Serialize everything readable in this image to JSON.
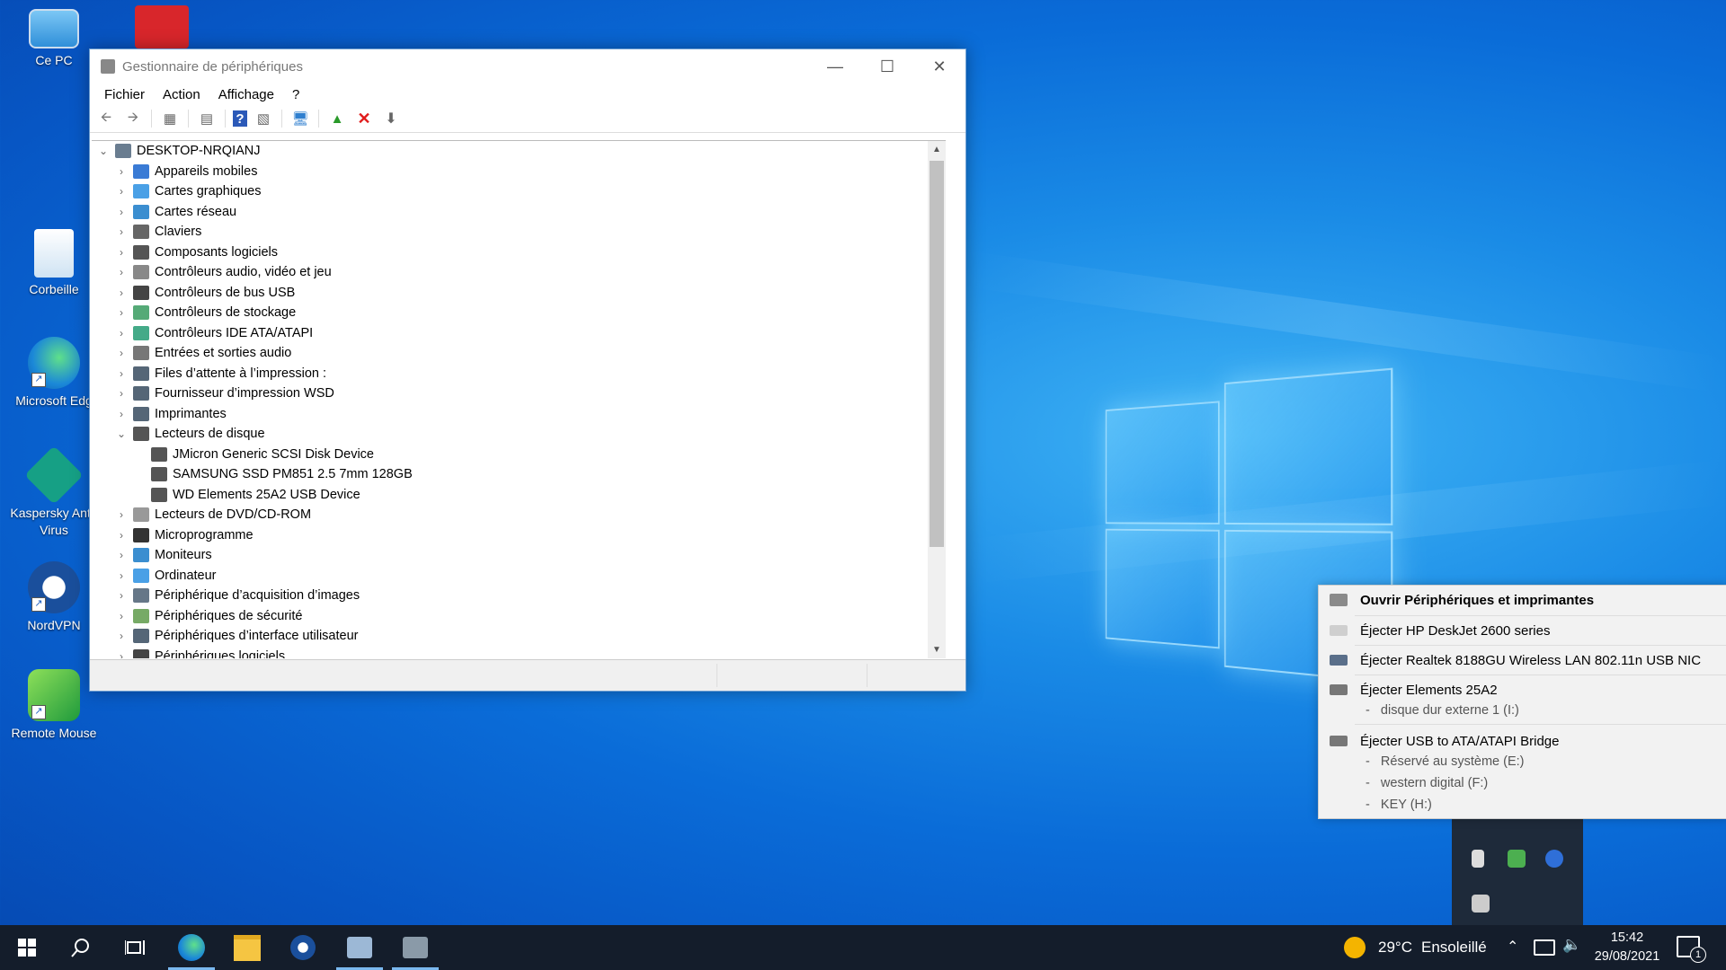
{
  "desktop": {
    "icons": [
      {
        "label": "Ce PC"
      },
      {
        "label": "Corbeille"
      },
      {
        "label": "Microsoft Edg"
      },
      {
        "label": "Kaspersky Anti-Virus"
      },
      {
        "label": "NordVPN"
      },
      {
        "label": "Remote Mouse"
      }
    ]
  },
  "window": {
    "title": "Gestionnaire de périphériques",
    "menu": [
      "Fichier",
      "Action",
      "Affichage",
      "?"
    ],
    "root": "DESKTOP-NRQIANJ",
    "categories": [
      "Appareils mobiles",
      "Cartes graphiques",
      "Cartes réseau",
      "Claviers",
      "Composants logiciels",
      "Contrôleurs audio, vidéo et jeu",
      "Contrôleurs de bus USB",
      "Contrôleurs de stockage",
      "Contrôleurs IDE ATA/ATAPI",
      "Entrées et sorties audio",
      "Files d’attente à l’impression :",
      "Fournisseur d’impression WSD",
      "Imprimantes",
      "Lecteurs de disque"
    ],
    "disk_drives": [
      "JMicron Generic SCSI Disk Device",
      "SAMSUNG SSD PM851 2.5 7mm 128GB",
      "WD Elements 25A2 USB Device"
    ],
    "categories_after": [
      "Lecteurs de DVD/CD-ROM",
      "Microprogramme",
      "Moniteurs",
      "Ordinateur",
      "Périphérique d’acquisition d’images",
      "Périphériques de sécurité",
      "Périphériques d’interface utilisateur",
      "Périphériques logiciels"
    ]
  },
  "flyout": {
    "open_label": "Ouvrir Périphériques et imprimantes",
    "items": [
      {
        "label": "Éjecter HP DeskJet 2600 series",
        "subs": []
      },
      {
        "label": "Éjecter Realtek 8188GU Wireless LAN 802.11n USB NIC",
        "subs": []
      },
      {
        "label": "Éjecter Elements 25A2",
        "subs": [
          "disque dur externe 1 (I:)"
        ]
      },
      {
        "label": "Éjecter USB to ATA/ATAPI Bridge",
        "subs": [
          "Réservé au système (E:)",
          "western digital (F:)",
          "KEY (H:)"
        ]
      }
    ]
  },
  "taskbar": {
    "weather_temp": "29°C",
    "weather_text": "Ensoleillé",
    "time": "15:42",
    "date": "29/08/2021",
    "notification_count": "1"
  }
}
